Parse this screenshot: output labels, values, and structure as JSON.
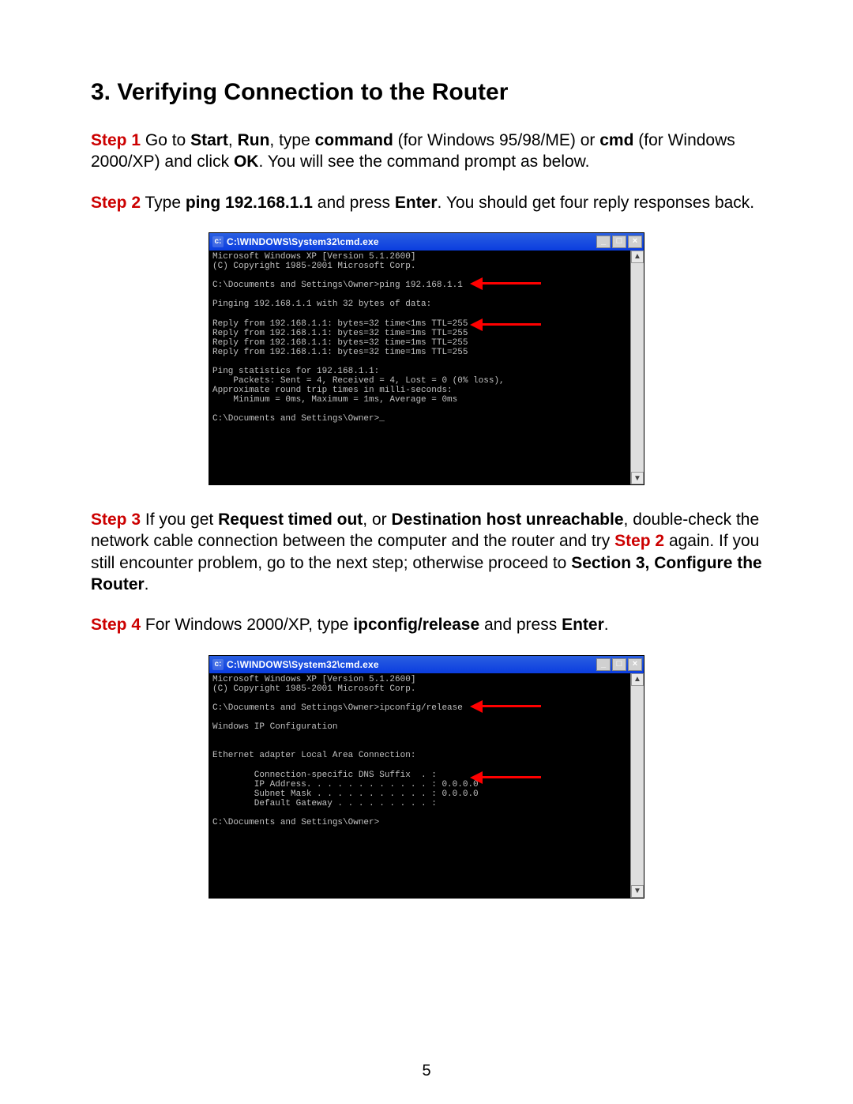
{
  "heading": "3. Verifying Connection to the Router",
  "steps": {
    "s1": {
      "label": "Step 1",
      "pre": " Go to ",
      "start": "Start",
      "sep1": ", ",
      "run": "Run",
      "sep2": ", type ",
      "command": "command",
      "mid": " (for Windows 95/98/ME) or ",
      "cmd": "cmd",
      "mid2": " (for Windows 2000/XP) and click ",
      "ok": "OK",
      "tail": ". You will see the command prompt as below."
    },
    "s2": {
      "label": "Step 2",
      "pre": " Type ",
      "ping": "ping 192.168.1.1",
      "mid": " and press ",
      "enter": "Enter",
      "tail": ". You should get four reply responses back."
    },
    "s3": {
      "label": "Step 3",
      "pre": " If you get ",
      "rto": "Request timed out",
      "sep1": ", or ",
      "dhu": "Destination host unreachable",
      "mid": ", double-check the network cable connection between the computer and the router and try ",
      "s2ref": "Step 2",
      "mid2": " again. If you still encounter problem, go to the next step; otherwise proceed to ",
      "section": "Section 3, Configure the Router",
      "period": "."
    },
    "s4": {
      "label": "Step 4",
      "pre": " For Windows 2000/XP, type ",
      "ipc": "ipconfig/release",
      "mid": " and press ",
      "enter": "Enter",
      "period": "."
    }
  },
  "cmd_window": {
    "title": "C:\\WINDOWS\\System32\\cmd.exe",
    "min_label": "_",
    "max_label": "□",
    "close_label": "×"
  },
  "cmd1": {
    "lines": "Microsoft Windows XP [Version 5.1.2600]\n(C) Copyright 1985-2001 Microsoft Corp.\n\nC:\\Documents and Settings\\Owner>ping 192.168.1.1\n\nPinging 192.168.1.1 with 32 bytes of data:\n\nReply from 192.168.1.1: bytes=32 time<1ms TTL=255\nReply from 192.168.1.1: bytes=32 time=1ms TTL=255\nReply from 192.168.1.1: bytes=32 time=1ms TTL=255\nReply from 192.168.1.1: bytes=32 time=1ms TTL=255\n\nPing statistics for 192.168.1.1:\n    Packets: Sent = 4, Received = 4, Lost = 0 (0% loss),\nApproximate round trip times in milli-seconds:\n    Minimum = 0ms, Maximum = 1ms, Average = 0ms\n\nC:\\Documents and Settings\\Owner>_\n\n\n\n\n\n\n"
  },
  "cmd2": {
    "lines": "Microsoft Windows XP [Version 5.1.2600]\n(C) Copyright 1985-2001 Microsoft Corp.\n\nC:\\Documents and Settings\\Owner>ipconfig/release\n\nWindows IP Configuration\n\n\nEthernet adapter Local Area Connection:\n\n        Connection-specific DNS Suffix  . :\n        IP Address. . . . . . . . . . . . : 0.0.0.0\n        Subnet Mask . . . . . . . . . . . : 0.0.0.0\n        Default Gateway . . . . . . . . . :\n\nC:\\Documents and Settings\\Owner>\n\n\n\n\n\n\n\n"
  },
  "page_number": "5"
}
